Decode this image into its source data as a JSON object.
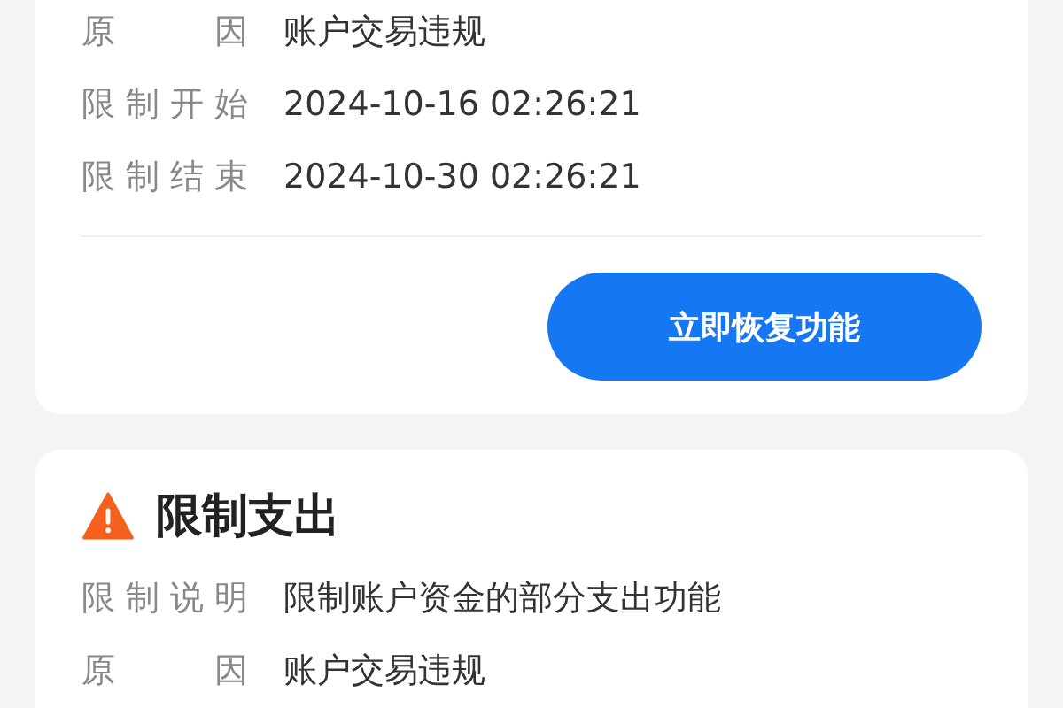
{
  "cards": [
    {
      "rows": [
        {
          "label": "原因",
          "value": "账户交易违规"
        },
        {
          "label": "限制开始",
          "value": "2024-10-16 02:26:21"
        },
        {
          "label": "限制结束",
          "value": "2024-10-30 02:26:21"
        }
      ],
      "button": "立即恢复功能"
    },
    {
      "title": "限制支出",
      "rows": [
        {
          "label": "限制说明",
          "value": "限制账户资金的部分支出功能"
        },
        {
          "label": "原因",
          "value": "账户交易违规"
        }
      ]
    }
  ]
}
